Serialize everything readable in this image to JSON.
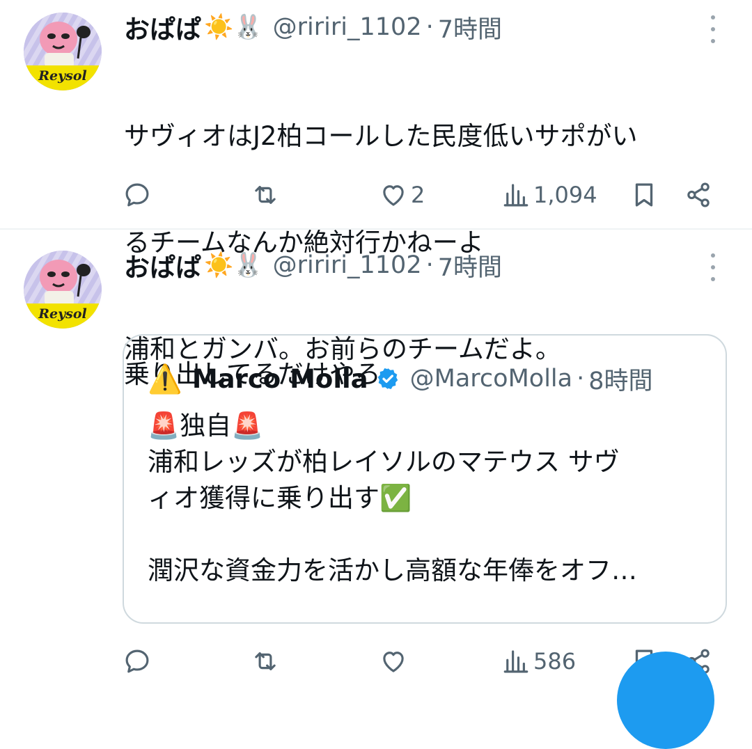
{
  "tweets": [
    {
      "display_name": "おぱぱ",
      "name_emojis": "☀️🐰",
      "handle": "@ririri_1102",
      "separator": "·",
      "time": "7時間",
      "text_lines": [
        "サヴィオはJ2柏コールした民度低いサポがい",
        "るチームなんか絶対行かねーよ",
        "浦和とガンバ。お前らのチームだよ。"
      ],
      "reply_count": "",
      "retweet_count": "",
      "like_count": "2",
      "view_count": "1,094"
    },
    {
      "display_name": "おぱぱ",
      "name_emojis": "☀️🐰",
      "handle": "@ririri_1102",
      "separator": "·",
      "time": "7時間",
      "text_lines": [
        "乗り出してるだけやろ"
      ],
      "reply_count": "",
      "retweet_count": "",
      "like_count": "",
      "view_count": "586"
    }
  ],
  "avatar_text": "Reysol",
  "quote": {
    "avatar_emoji": "⚠️",
    "display_name": "Marco Molla",
    "verified": true,
    "handle": "@MarcoMolla",
    "separator": "·",
    "time": "8時間",
    "line1": "🚨独自🚨",
    "line2": "浦和レッズが柏レイソルのマテウス サヴ",
    "line3": "ィオ獲得に乗り出す✅",
    "line4": "",
    "line5": "潤沢な資金力を活かし高額な年俸をオフ…"
  },
  "icons": {
    "reply": "reply-icon",
    "retweet": "retweet-icon",
    "like": "heart-icon",
    "views": "views-icon",
    "bookmark": "bookmark-icon",
    "share": "share-icon",
    "more": "more-icon"
  },
  "colors": {
    "text": "#0f1419",
    "secondary": "#536471",
    "accent": "#1d9bf0",
    "border": "#cfd9de",
    "divider": "#eff3f4",
    "avatar_band": "#f5e400"
  }
}
